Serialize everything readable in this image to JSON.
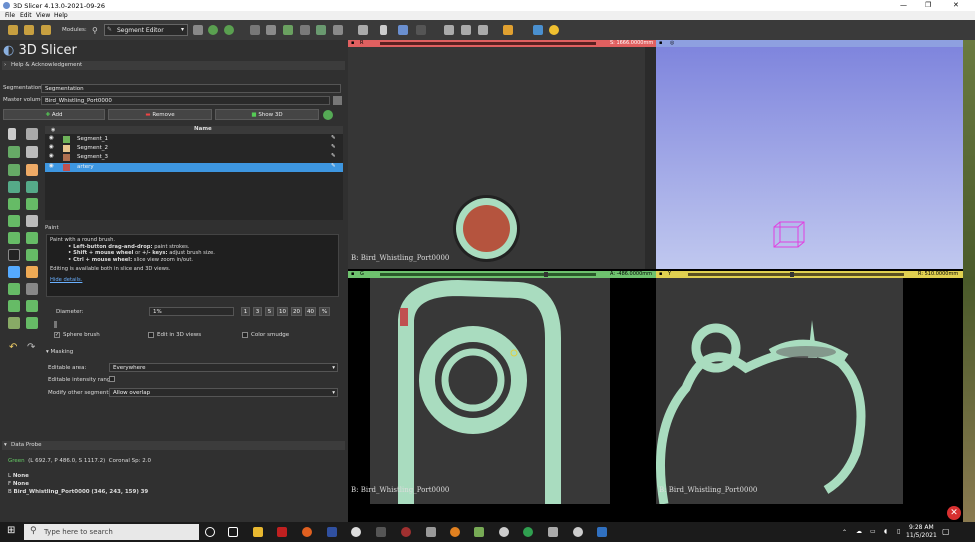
{
  "window": {
    "title": "3D Slicer 4.13.0-2021-09-26",
    "min": "—",
    "max": "❐",
    "close": "✕"
  },
  "menu": [
    "File",
    "Edit",
    "View",
    "Help"
  ],
  "toolbar": {
    "modules_label": "Modules:",
    "module": "Segment Editor"
  },
  "app": {
    "logo": "3D Slicer",
    "help_section": "Help & Acknowledgement"
  },
  "editor": {
    "segmentation_label": "Segmentation:",
    "segmentation": "Segmentation",
    "master_label": "Master volume:",
    "master": "Bird_Whistling_Port0000",
    "add": "Add",
    "remove": "Remove",
    "show3d": "Show 3D",
    "name_header": "Name"
  },
  "segments": [
    {
      "name": "Segment_1",
      "color": "#6fb35a"
    },
    {
      "name": "Segment_2",
      "color": "#e8c690"
    },
    {
      "name": "Segment_3",
      "color": "#b07050"
    },
    {
      "name": "artery",
      "color": "#c05050"
    }
  ],
  "paint": {
    "title": "Paint",
    "desc": "Paint with a round brush.",
    "b1a": "• Left-button drag-and-drop:",
    "b1b": " paint strokes.",
    "b2a": "• Shift + mouse wheel",
    "b2m": " or ",
    "b2k": "+/- keys:",
    "b2b": " adjust brush size.",
    "b3a": "• Ctrl + mouse wheel:",
    "b3b": " slice view zoom in/out.",
    "note": "Editing is available both in slice and 3D views.",
    "hide": "Hide details.",
    "diameter_label": "Diameter:",
    "diameter": "1%",
    "presets": [
      "1",
      "3",
      "5",
      "10",
      "20",
      "40",
      "%"
    ],
    "sphere": "Sphere brush",
    "edit3d": "Edit in 3D views",
    "smudge": "Color smudge",
    "check": "✓"
  },
  "masking": {
    "title": "Masking",
    "area_label": "Editable area:",
    "area": "Everywhere",
    "range_label": "Editable intensity range:",
    "modify_label": "Modify other segments:",
    "modify": "Allow overlap"
  },
  "probe": {
    "title": "Data Probe",
    "view": "Green",
    "coords": "(L 692.7, P 486.0, S 1117.2)",
    "spacing": "Coronal Sp: 2.0",
    "l": "L",
    "l_val": "None",
    "f": "F",
    "f_val": "None",
    "b": "B",
    "b_val": "Bird_Whistling_Port0000",
    "b_idx": "(346, 243, 159)",
    "b_v": "39"
  },
  "views": {
    "red_offset": "S: 1666.0000mm",
    "green_offset": "A: -486.0000mm",
    "yellow_offset": "R: 510.0000mm",
    "red_label": "B: Bird_Whistling_Port0000",
    "green_label": "B: Bird_Whistling_Port0000",
    "yellow_label": "B: Bird_Whistling_Port0000",
    "green_tag": "G",
    "yellow_tag": "Y",
    "red_tag": "R"
  },
  "taskbar": {
    "search": "Type here to search",
    "time": "9:28 AM",
    "date": "11/5/2021"
  }
}
